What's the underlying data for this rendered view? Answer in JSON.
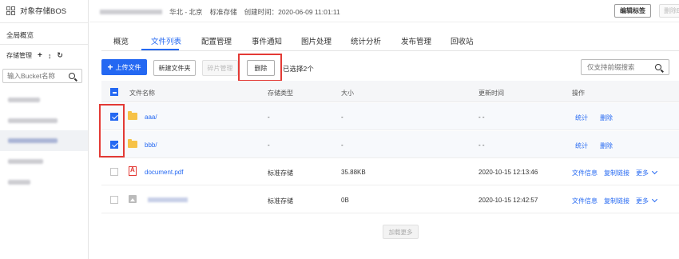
{
  "sidebar": {
    "title": "对象存储BOS",
    "overview": "全局概览",
    "storage_management": "存储管理",
    "search_placeholder": "输入Bucket名称"
  },
  "topbar": {
    "region": "华北 - 北京",
    "storage_class": "标准存储",
    "created_label": "创建时间：",
    "created_time": "2020-06-09 11:01:11",
    "edit_tag_label": "编辑标签",
    "delete_bucket_label": "删除B"
  },
  "tabs": [
    "概览",
    "文件列表",
    "配置管理",
    "事件通知",
    "图片处理",
    "统计分析",
    "发布管理",
    "回收站"
  ],
  "toolbar": {
    "upload_label": "上传文件",
    "new_folder_label": "新建文件夹",
    "fragment_label": "碎片管理",
    "delete_label": "删除",
    "selected_text": "已选择2个",
    "search_placeholder": "仅支持前缀搜索"
  },
  "table": {
    "headers": [
      "文件名称",
      "存储类型",
      "大小",
      "更新时间",
      "操作"
    ],
    "rows": [
      {
        "name": "aaa/",
        "type": "-",
        "size": "-",
        "time": "- -",
        "op1": "统计",
        "op2": "删除",
        "checked": true
      },
      {
        "name": "bbb/",
        "type": "-",
        "size": "-",
        "time": "- -",
        "op1": "统计",
        "op2": "删除",
        "checked": true
      },
      {
        "name": "document.pdf",
        "type": "标准存储",
        "size": "35.88KB",
        "time": "2020-10-15 12:13:46",
        "op1": "文件信息",
        "op2": "复制链接",
        "op3": "更多",
        "checked": false
      },
      {
        "name": "",
        "type": "标准存储",
        "size": "0B",
        "time": "2020-10-15 12:42:57",
        "op1": "文件信息",
        "op2": "复制链接",
        "op3": "更多",
        "checked": false
      }
    ]
  },
  "load_more_label": "加载更多",
  "colors": {
    "accent": "#2468f2",
    "highlight": "#e33a35",
    "folder": "#f6c247"
  }
}
